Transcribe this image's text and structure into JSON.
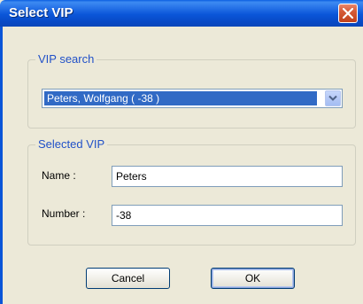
{
  "window": {
    "title": "Select VIP",
    "close_icon": "close-x-icon"
  },
  "vip_search": {
    "legend": "VIP search",
    "selected_value": "Peters, Wolfgang  ( -38 )",
    "dropdown_icon": "chevron-down-icon"
  },
  "selected_vip": {
    "legend": "Selected VIP",
    "name_label": "Name :",
    "name_value": "Peters",
    "number_label": "Number :",
    "number_value": "-38"
  },
  "buttons": {
    "cancel_label": "Cancel",
    "ok_label": "OK"
  },
  "colors": {
    "titlebar": "#0a55d8",
    "dialog_bg": "#ece9d8",
    "legend_text": "#2151c8",
    "selection": "#316ac5",
    "close_button": "#d55a36"
  }
}
